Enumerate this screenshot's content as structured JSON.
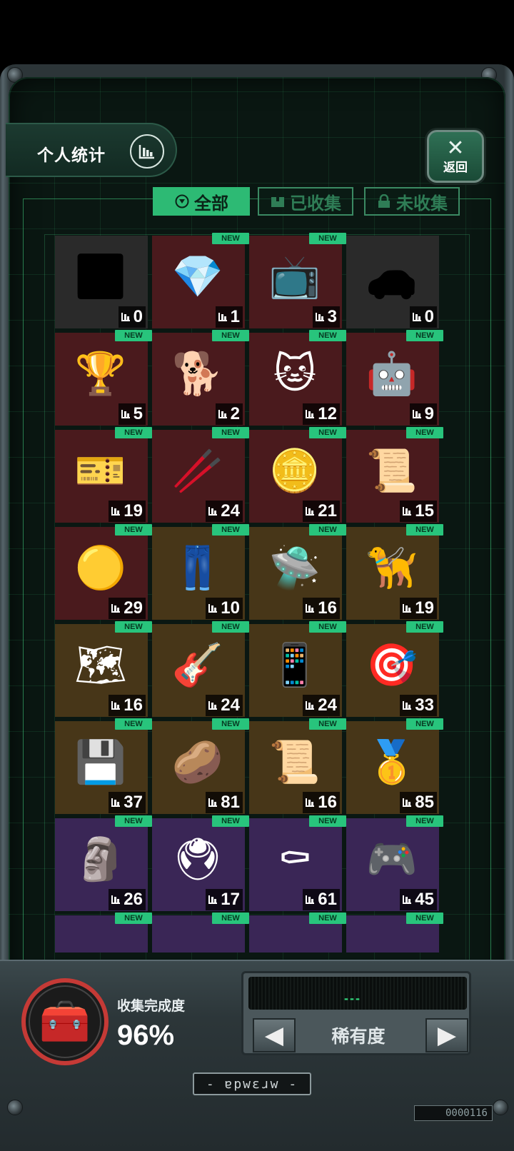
{
  "header": {
    "stats_label": "个人统计",
    "close_label": "返回"
  },
  "tabs": [
    {
      "label": "全部",
      "icon": "filter-icon",
      "active": true
    },
    {
      "label": "已收集",
      "icon": "box-icon",
      "active": false
    },
    {
      "label": "未收集",
      "icon": "lock-icon",
      "active": false
    }
  ],
  "new_badge": "NEW",
  "items": [
    [
      {
        "icon": "locked-silhouette-plant",
        "count": "0",
        "new": false,
        "bg": "#2a2a2a",
        "pic": "⬛"
      },
      {
        "icon": "gem-icon",
        "count": "1",
        "new": true,
        "bg": "#4a1a1d",
        "pic": "💎"
      },
      {
        "icon": "retro-tv-icon",
        "count": "3",
        "new": true,
        "bg": "#4a1a1d",
        "pic": "📺"
      },
      {
        "icon": "locked-silhouette-car",
        "count": "0",
        "new": false,
        "bg": "#2a2a2a",
        "pic": "🚗"
      }
    ],
    [
      {
        "icon": "trophy-glass-icon",
        "count": "5",
        "new": true,
        "bg": "#4a1a1d",
        "pic": "🏆"
      },
      {
        "icon": "statue-dog-icon",
        "count": "2",
        "new": true,
        "bg": "#4a1a1d",
        "pic": "🐕"
      },
      {
        "icon": "cat-mascot-icon",
        "count": "12",
        "new": true,
        "bg": "#4a1a1d",
        "pic": "🐱"
      },
      {
        "icon": "robot-ship-icon",
        "count": "9",
        "new": true,
        "bg": "#4a1a1d",
        "pic": "🤖"
      }
    ],
    [
      {
        "icon": "red-card-icon",
        "count": "19",
        "new": true,
        "bg": "#4a1a1d",
        "pic": "🎫"
      },
      {
        "icon": "chopsticks-icon",
        "count": "24",
        "new": true,
        "bg": "#4a1a1d",
        "pic": "🥢"
      },
      {
        "icon": "silver-coin-icon",
        "count": "21",
        "new": true,
        "bg": "#4a1a1d",
        "pic": "🪙"
      },
      {
        "icon": "certificate-icon",
        "count": "15",
        "new": true,
        "bg": "#4a1a1d",
        "pic": "📜"
      }
    ],
    [
      {
        "icon": "bitcoin-icon",
        "count": "29",
        "new": true,
        "bg": "#4a1a1d",
        "pic": "🟡"
      },
      {
        "icon": "overalls-icon",
        "count": "10",
        "new": true,
        "bg": "#473618",
        "pic": "👖"
      },
      {
        "icon": "drone-icon",
        "count": "16",
        "new": true,
        "bg": "#473618",
        "pic": "🛸"
      },
      {
        "icon": "robot-dog-icon",
        "count": "19",
        "new": true,
        "bg": "#473618",
        "pic": "🦮"
      }
    ],
    [
      {
        "icon": "folded-map-icon",
        "count": "16",
        "new": true,
        "bg": "#473618",
        "pic": "🗺"
      },
      {
        "icon": "guitar-icon",
        "count": "24",
        "new": true,
        "bg": "#473618",
        "pic": "🎸"
      },
      {
        "icon": "phone-icon",
        "count": "24",
        "new": true,
        "bg": "#473618",
        "pic": "📱"
      },
      {
        "icon": "spinning-top-icon",
        "count": "33",
        "new": true,
        "bg": "#473618",
        "pic": "🎯"
      }
    ],
    [
      {
        "icon": "graphics-card-icon",
        "count": "37",
        "new": true,
        "bg": "#473618",
        "pic": "💾"
      },
      {
        "icon": "toy-bean-icon",
        "count": "81",
        "new": true,
        "bg": "#473618",
        "pic": "🥔"
      },
      {
        "icon": "certificate-icon",
        "count": "16",
        "new": true,
        "bg": "#473618",
        "pic": "📜"
      },
      {
        "icon": "gold-ingot-icon",
        "count": "85",
        "new": true,
        "bg": "#473618",
        "pic": "🥇"
      }
    ],
    [
      {
        "icon": "terracotta-warrior-icon",
        "count": "26",
        "new": true,
        "bg": "#3a2656",
        "pic": "🗿"
      },
      {
        "icon": "device-icon",
        "count": "17",
        "new": true,
        "bg": "#3a2656",
        "pic": "🖲"
      },
      {
        "icon": "coffin-dancers-icon",
        "count": "61",
        "new": true,
        "bg": "#3a2656",
        "pic": "⚰"
      },
      {
        "icon": "bmo-robot-icon",
        "count": "45",
        "new": true,
        "bg": "#3a2656",
        "pic": "🎮"
      }
    ],
    [
      {
        "icon": "item-icon",
        "count": "",
        "new": true,
        "bg": "#3a2656",
        "pic": ""
      },
      {
        "icon": "item-icon",
        "count": "",
        "new": true,
        "bg": "#3a2656",
        "pic": ""
      },
      {
        "icon": "item-icon",
        "count": "",
        "new": true,
        "bg": "#3a2656",
        "pic": ""
      },
      {
        "icon": "item-icon",
        "count": "",
        "new": true,
        "bg": "#3a2656",
        "pic": ""
      }
    ]
  ],
  "collection": {
    "label": "收集完成度",
    "value": "96%"
  },
  "rarity": {
    "display": "---",
    "label": "稀有度"
  },
  "nameplate": "- ɐpwɛɹw -",
  "serial": "0000116"
}
